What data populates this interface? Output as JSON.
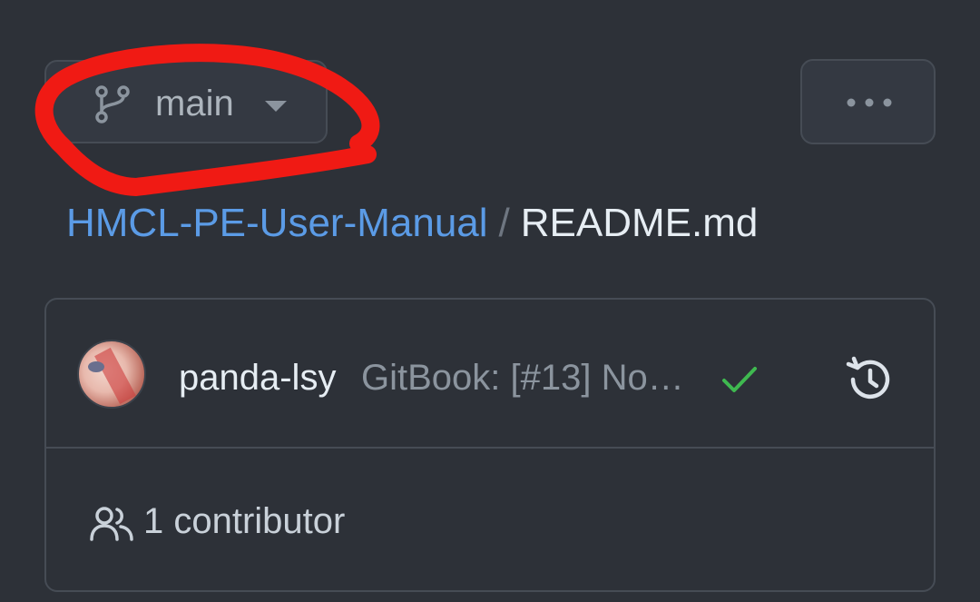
{
  "toolbar": {
    "branch_label": "main",
    "more_label": "More options"
  },
  "breadcrumb": {
    "repo": "HMCL-PE-User-Manual",
    "separator": "/",
    "file": "README.md"
  },
  "commit": {
    "author": "panda-lsy",
    "message": "GitBook: [#13] No…",
    "status": "success"
  },
  "contributors": {
    "label": "1 contributor"
  },
  "colors": {
    "background": "#2d3138",
    "link": "#5b9be6",
    "success": "#3fb950",
    "annotation": "#f01a14"
  },
  "icons": {
    "branch": "git-branch-icon",
    "caret": "caret-down-icon",
    "more": "kebab-horizontal-icon",
    "check": "check-icon",
    "history": "history-icon",
    "people": "people-icon"
  }
}
